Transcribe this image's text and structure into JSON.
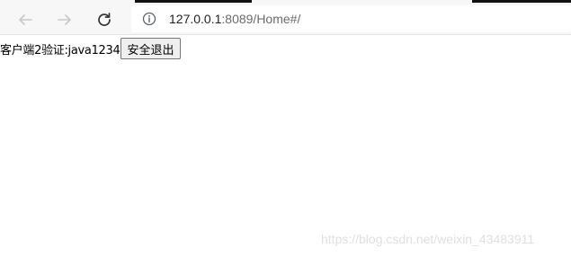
{
  "browser": {
    "url_host": "127.0.0.1",
    "url_rest": ":8089/Home#/",
    "icons": {
      "back": "arrow-left-icon",
      "forward": "arrow-right-icon",
      "reload": "reload-icon",
      "info": "info-circle-icon"
    }
  },
  "page": {
    "client_label": "客户端2验证:java1234",
    "logout_label": "安全退出"
  },
  "watermark": {
    "text": "https://blog.csdn.net/weixin_43483911"
  }
}
